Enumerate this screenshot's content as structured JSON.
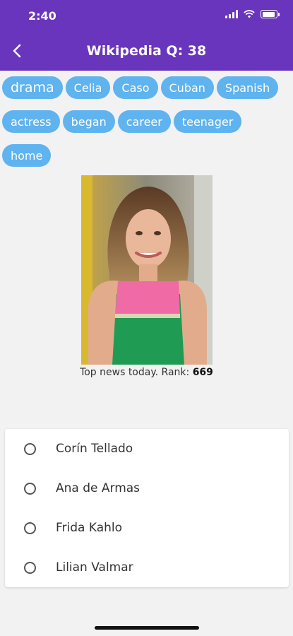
{
  "status_bar": {
    "time": "2:40",
    "battery_level": 0.9
  },
  "app_bar": {
    "title": "Wikipedia Q: 38",
    "back_icon": "chevron-left-icon"
  },
  "chips": [
    "drama",
    "Celia",
    "Caso",
    "Cuban",
    "Spanish",
    "actress",
    "began",
    "career",
    "teenager",
    "home"
  ],
  "caption": {
    "text": "Top news today. Rank: ",
    "rank": "669"
  },
  "options": [
    {
      "label": "Corín Tellado"
    },
    {
      "label": "Ana de Armas"
    },
    {
      "label": "Frida Kahlo"
    },
    {
      "label": "Lilian Valmar"
    }
  ],
  "colors": {
    "app_bar": "#6a35bd",
    "chip": "#5fb3ef"
  }
}
